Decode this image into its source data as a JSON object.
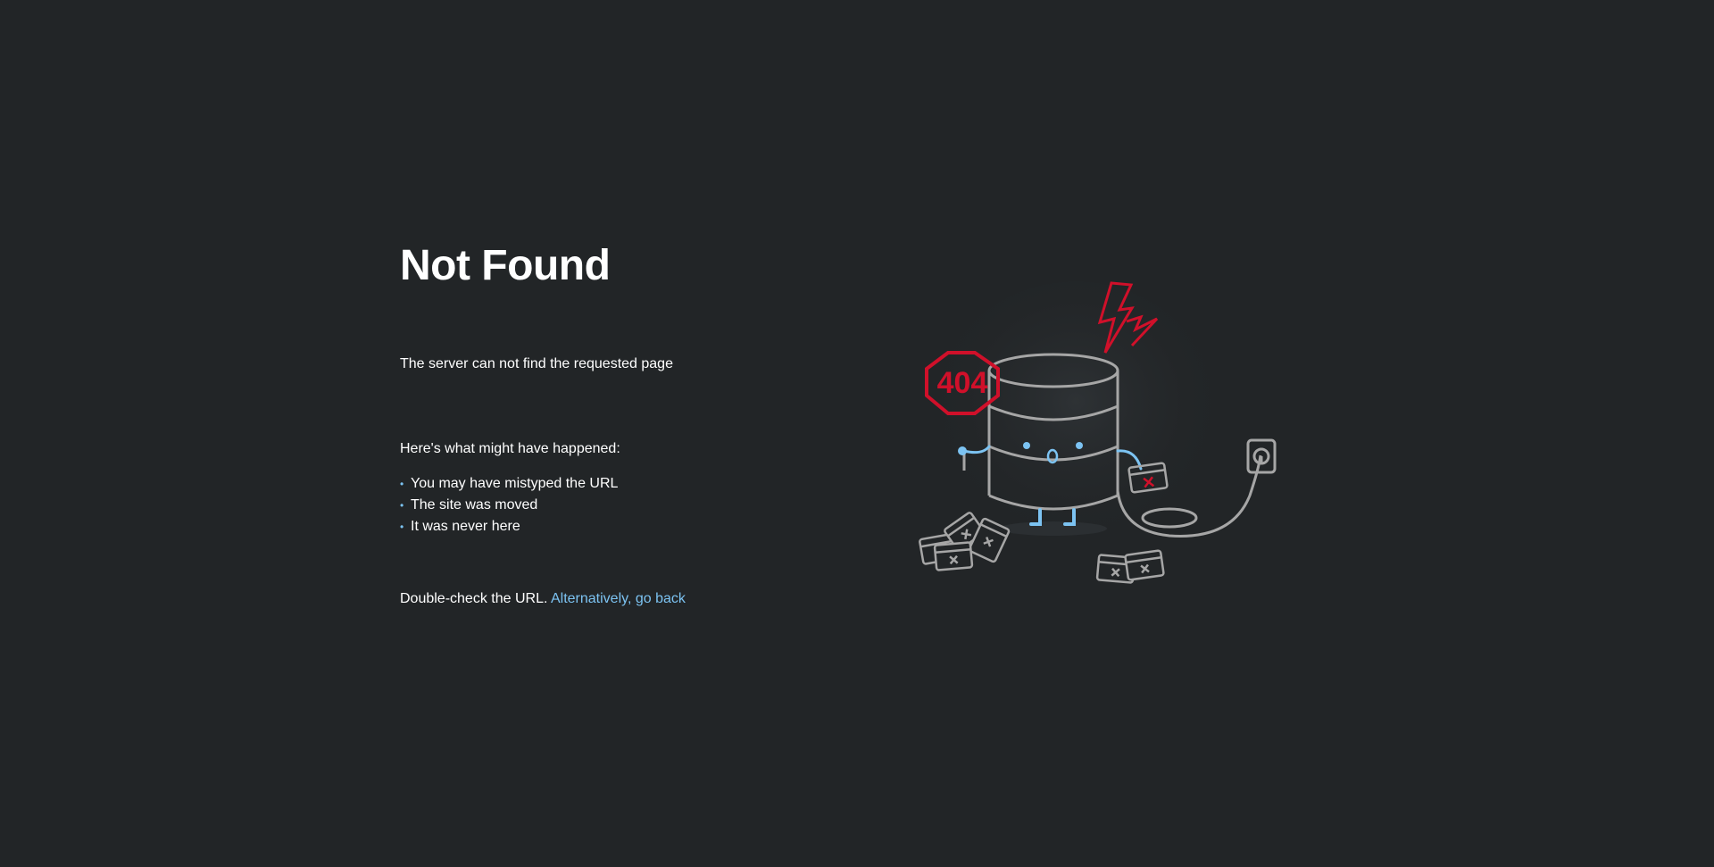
{
  "page": {
    "title": "Not Found",
    "lead": "The server can not find the requested page",
    "reasons_heading": "Here's what might have happened:",
    "reasons": [
      "You may have mistyped the URL",
      "The site was moved",
      "It was never here"
    ],
    "footer_text": "Double-check the URL.",
    "back_link_label": "Alternatively, go back"
  },
  "illustration": {
    "sign_text": "404",
    "icons": [
      "database-icon",
      "stop-sign-icon",
      "lightning-icon",
      "power-outlet-icon",
      "broken-window-icon"
    ]
  },
  "colors": {
    "background": "#222527",
    "text": "#ffffff",
    "accent": "#7cc3f2",
    "error": "#d0102a",
    "outline": "#a6a6a6"
  }
}
